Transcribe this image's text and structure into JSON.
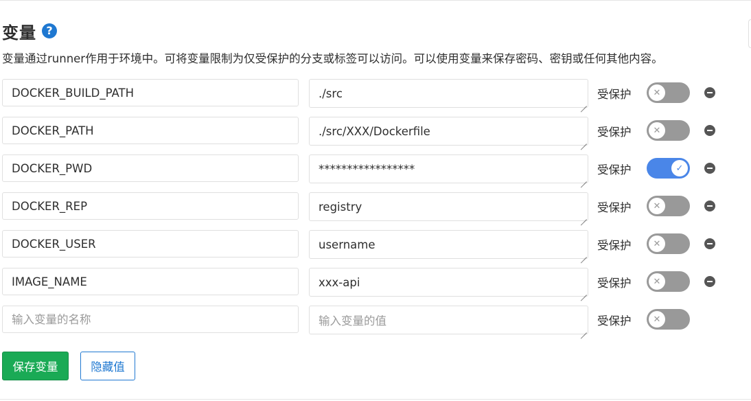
{
  "section": {
    "title": "变量",
    "help_icon": "question-circle-icon",
    "description": "变量通过runner作用于环境中。可将变量限制为仅受保护的分支或标签可以访问。可以使用变量来保存密码、密钥或任何其他内容。"
  },
  "variables": [
    {
      "key": "DOCKER_BUILD_PATH",
      "value": "./src",
      "protected_label": "受保护",
      "protected": false
    },
    {
      "key": "DOCKER_PATH",
      "value": "./src/XXX/Dockerfile",
      "protected_label": "受保护",
      "protected": false
    },
    {
      "key": "DOCKER_PWD",
      "value": "*****************",
      "protected_label": "受保护",
      "protected": true
    },
    {
      "key": "DOCKER_REP",
      "value": "registry",
      "protected_label": "受保护",
      "protected": false
    },
    {
      "key": "DOCKER_USER",
      "value": "username",
      "protected_label": "受保护",
      "protected": false
    },
    {
      "key": "IMAGE_NAME",
      "value": "xxx-api",
      "protected_label": "受保护",
      "protected": false
    }
  ],
  "new_variable": {
    "key_placeholder": "输入变量的名称",
    "value_placeholder": "输入变量的值",
    "protected_label": "受保护",
    "protected": false
  },
  "buttons": {
    "save_label": "保存变量",
    "reveal_label": "隐藏值"
  },
  "colors": {
    "save_button": "#1aaa55",
    "reveal_button_border": "#1f78d1",
    "toggle_on": "#4a86e8",
    "toggle_off": "#999999"
  }
}
